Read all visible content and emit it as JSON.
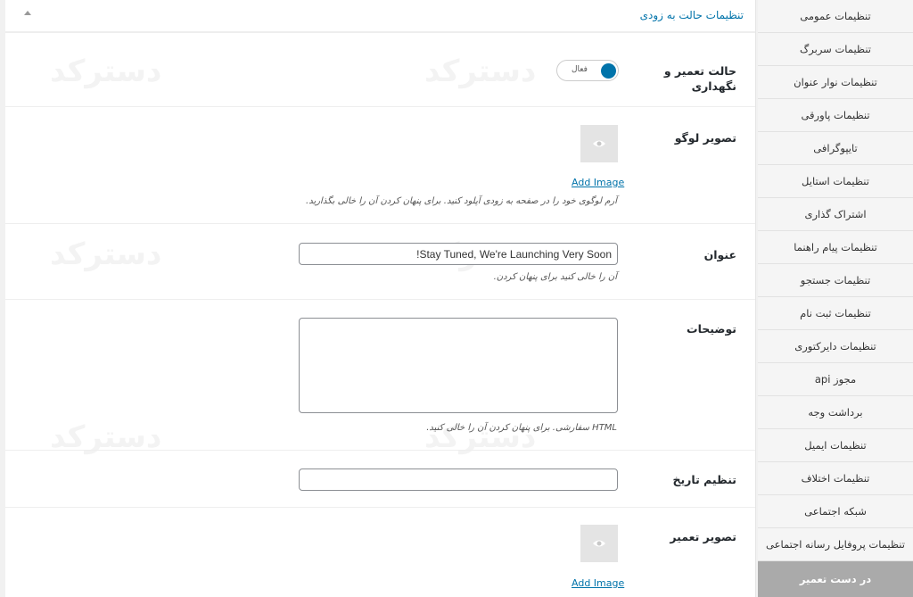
{
  "sidebar": {
    "items": [
      {
        "label": "تنظیمات عمومی"
      },
      {
        "label": "تنظیمات سربرگ"
      },
      {
        "label": "تنظیمات نوار عنوان"
      },
      {
        "label": "تنظیمات پاورقی"
      },
      {
        "label": "تایپوگرافی"
      },
      {
        "label": "تنظیمات استایل"
      },
      {
        "label": "اشتراک گذاری"
      },
      {
        "label": "تنظیمات پیام راهنما"
      },
      {
        "label": "تنظیمات جستجو"
      },
      {
        "label": "تنظیمات ثبت نام"
      },
      {
        "label": "تنظیمات دایرکتوری"
      },
      {
        "label": "مجوز api"
      },
      {
        "label": "برداشت وجه"
      },
      {
        "label": "تنظیمات ایمیل"
      },
      {
        "label": "تنظیمات اختلاف"
      },
      {
        "label": "شبکه اجتماعی"
      },
      {
        "label": "تنظیمات پروفایل رسانه اجتماعی"
      },
      {
        "label": "در دست تعمیر"
      }
    ]
  },
  "header": {
    "title": "تنظیمات حالت به زودی"
  },
  "maintenance": {
    "label": "حالت تعمیر و نگهداری",
    "toggle_label": "فعال"
  },
  "logo": {
    "label": "تصویر لوگو",
    "add_image": "Add Image",
    "description": "آرم لوگوی خود را در صفحه به زودی آپلود کنید. برای پنهان کردن آن را خالی بگذارید."
  },
  "title_field": {
    "label": "عنوان",
    "value": "!Stay Tuned, We're Launching Very Soon",
    "description": "آن را خالی کنید برای پنهان کردن."
  },
  "description_field": {
    "label": "توضیحات",
    "value": "",
    "description": "HTML سفارشی. برای پنهان کردن آن را خالی کنید."
  },
  "date_field": {
    "label": "تنظیم تاریخ",
    "value": ""
  },
  "repair_image": {
    "label": "تصویر تعمیر",
    "add_image": "Add Image"
  },
  "watermark": {
    "text": "دسترکد"
  }
}
